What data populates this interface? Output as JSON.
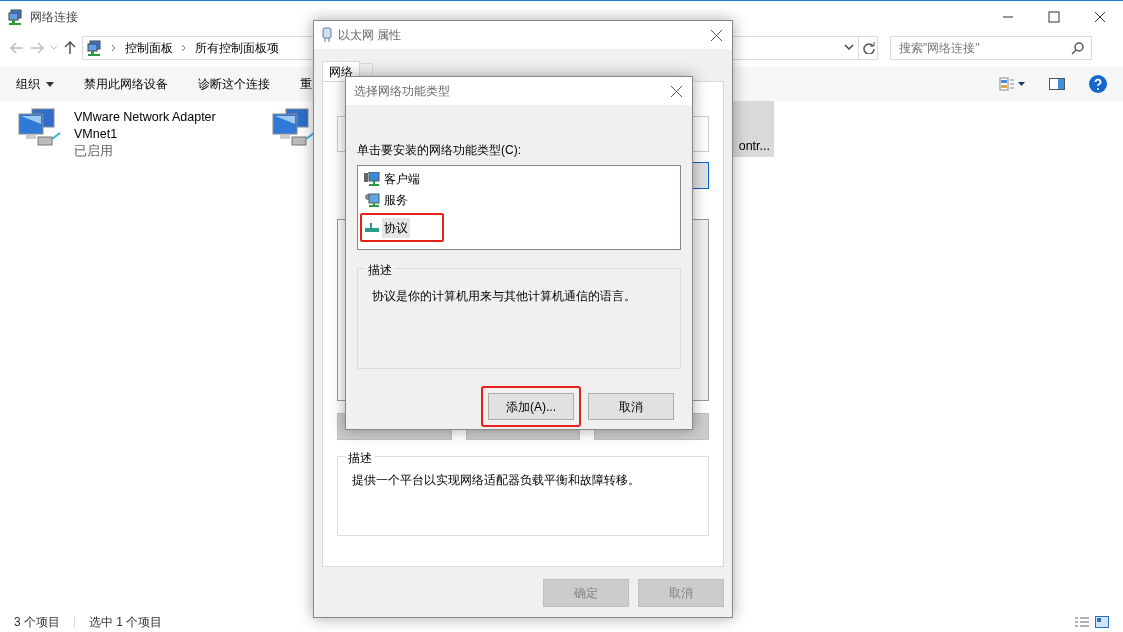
{
  "explorer": {
    "title": "网络连接",
    "breadcrumbs": [
      "控制面板",
      "所有控制面板项"
    ],
    "search": {
      "placeholder": "搜索\"网络连接\""
    },
    "toolbar": [
      {
        "label": "组织",
        "dropdown": true
      },
      {
        "label": "禁用此网络设备",
        "dropdown": false
      },
      {
        "label": "诊断这个连接",
        "dropdown": false
      },
      {
        "label": "重",
        "dropdown": false
      }
    ],
    "items": [
      {
        "lines": [
          "VMware Network Adapter",
          "VMnet1",
          "已启用"
        ],
        "selected": false
      },
      {
        "lines": [
          "ontr..."
        ],
        "selected": true
      }
    ],
    "status_bar": [
      "3 个项目",
      "选中 1 个项目"
    ]
  },
  "properties": {
    "title": "以太网 属性",
    "tabs": [
      {
        "label": "网络",
        "selected": true
      },
      {
        "selected": false
      }
    ],
    "description": {
      "legend": "描述",
      "text": "提供一个平台以实现网络适配器负载平衡和故障转移。"
    },
    "buttons": [
      {
        "label": "确定",
        "disabled": true
      },
      {
        "label": "取消",
        "disabled": true
      }
    ]
  },
  "dialog": {
    "title": "选择网络功能类型",
    "prompt": "单击要安装的网络功能类型(C):",
    "types": [
      {
        "label": "客户端",
        "kind": "client",
        "selected": false,
        "highlighted": false
      },
      {
        "label": "服务",
        "kind": "service",
        "selected": false,
        "highlighted": false
      },
      {
        "label": "协议",
        "kind": "protocol",
        "selected": true,
        "highlighted": true
      }
    ],
    "description": {
      "legend": "描述",
      "text": "协议是你的计算机用来与其他计算机通信的语言。"
    },
    "buttons": [
      {
        "label": "添加(A)...",
        "highlighted": true
      },
      {
        "label": "取消",
        "highlighted": false
      }
    ]
  }
}
